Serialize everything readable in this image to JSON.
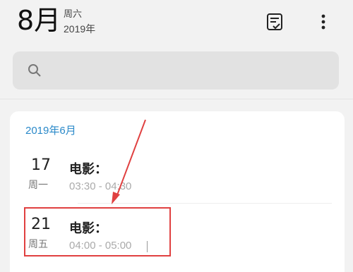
{
  "header": {
    "month_label": "8月",
    "weekday_label": "周六",
    "year_label": "2019年"
  },
  "icons": {
    "tasks": "task-list-icon",
    "more": "more-vertical-icon",
    "search": "search-icon"
  },
  "search": {
    "placeholder": "",
    "value": ""
  },
  "agenda": {
    "month_header": "2019年6月",
    "events": [
      {
        "day": "17",
        "weekday": "周一",
        "title": "电影：",
        "time": "03:30 - 04:30"
      },
      {
        "day": "21",
        "weekday": "周五",
        "title": "电影：",
        "time": "04:00 - 05:00"
      }
    ]
  },
  "colors": {
    "accent": "#2a89c9",
    "annotation_red": "#e04040"
  }
}
